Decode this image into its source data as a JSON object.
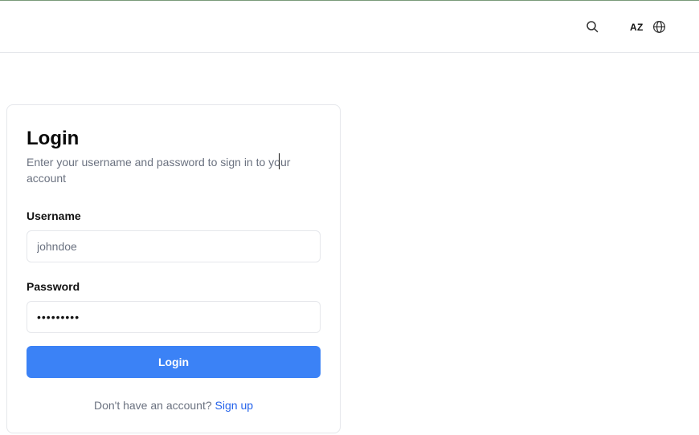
{
  "header": {
    "search_icon": "search-icon",
    "language_code": "AZ",
    "globe_icon": "globe-icon"
  },
  "login_card": {
    "title": "Login",
    "description": "Enter your username and password to sign in to your account",
    "username": {
      "label": "Username",
      "placeholder": "johndoe",
      "value": ""
    },
    "password": {
      "label": "Password",
      "value": "password1"
    },
    "submit_label": "Login",
    "signup_prompt": "Don't have an account?",
    "signup_link": "Sign up"
  },
  "colors": {
    "primary": "#3b82f6",
    "link": "#2563eb",
    "muted_text": "#6b7280",
    "border": "#e5e7eb",
    "top_accent": "#7a9a7a"
  }
}
